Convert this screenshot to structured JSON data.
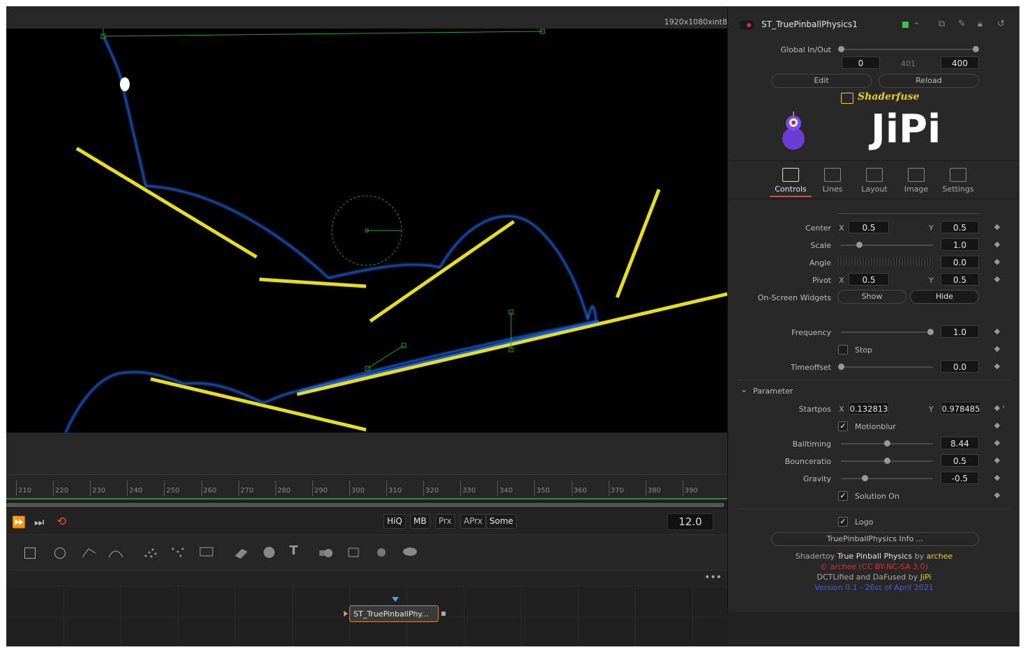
{
  "viewer": {
    "resolution": "1920x1080xint8",
    "colors": {
      "track": "#1c5fd6",
      "bars": "#e8e02a",
      "widgets": "#2aa02a"
    }
  },
  "timeline": {
    "ticks": [
      "210",
      "220",
      "230",
      "240",
      "250",
      "260",
      "270",
      "280",
      "290",
      "300",
      "310",
      "320",
      "330",
      "340",
      "350",
      "360",
      "370",
      "380",
      "390"
    ]
  },
  "transport": {
    "toggles": [
      "HiQ",
      "MB",
      "Prx",
      "APrx",
      "Some"
    ],
    "timecode": "12.0"
  },
  "nodes": {
    "node_label": "ST_TruePinballPhy..."
  },
  "inspector": {
    "tool_name": "ST_TruePinballPhysics1",
    "global_inout": {
      "label": "Global In/Out",
      "in": "0",
      "duration": "401",
      "out": "400"
    },
    "edit": "Edit",
    "reload": "Reload",
    "shaderfuse": "Shaderfuse",
    "brand": "JiPi",
    "tabs": [
      "Controls",
      "Lines",
      "Layout",
      "Image",
      "Settings"
    ],
    "center": {
      "label": "Center",
      "x_axis": "X",
      "y_axis": "Y",
      "x": "0.5",
      "y": "0.5"
    },
    "scale": {
      "label": "Scale",
      "value": "1.0",
      "level": 0.2
    },
    "angle": {
      "label": "Angle",
      "value": "0.0"
    },
    "pivot": {
      "label": "Pivot",
      "x_axis": "X",
      "y_axis": "Y",
      "x": "0.5",
      "y": "0.5"
    },
    "widgets": {
      "label": "On-Screen Widgets",
      "show": "Show",
      "hide": "Hide"
    },
    "frequency": {
      "label": "Frequency",
      "value": "1.0",
      "level": 0.97
    },
    "stop": {
      "label": "Stop"
    },
    "timeoffset": {
      "label": "Timeoffset",
      "value": "0.0",
      "level": 0.0
    },
    "parameter_header": "Parameter",
    "startpos": {
      "label": "Startpos",
      "x_axis": "X",
      "y_axis": "Y",
      "x": "0.132813",
      "y": "0.978485"
    },
    "motionblur": {
      "label": "Motionblur",
      "check": "✓"
    },
    "balltiming": {
      "label": "Balltiming",
      "value": "8.44",
      "level": 0.5
    },
    "bounceratio": {
      "label": "Bounceratio",
      "value": "0.5",
      "level": 0.5
    },
    "gravity": {
      "label": "Gravity",
      "value": "-0.5",
      "level": 0.26
    },
    "solution": {
      "label": "Solution On",
      "check": "✓"
    },
    "logo": {
      "label": "Logo",
      "check": "✓"
    },
    "info_button": "TruePinballPhysics Info ...",
    "credits": {
      "l1a": "Shadertoy",
      "l1b": "True Pinball Physics",
      "l1c": "by",
      "l1d": "archee",
      "l2": "© archee (CC BY-NC-SA 3.0)",
      "l3a": "DCTLified and DaFused by",
      "l3b": "JiPi",
      "l4": "Version 0.1 - 26st of April 2021"
    }
  }
}
